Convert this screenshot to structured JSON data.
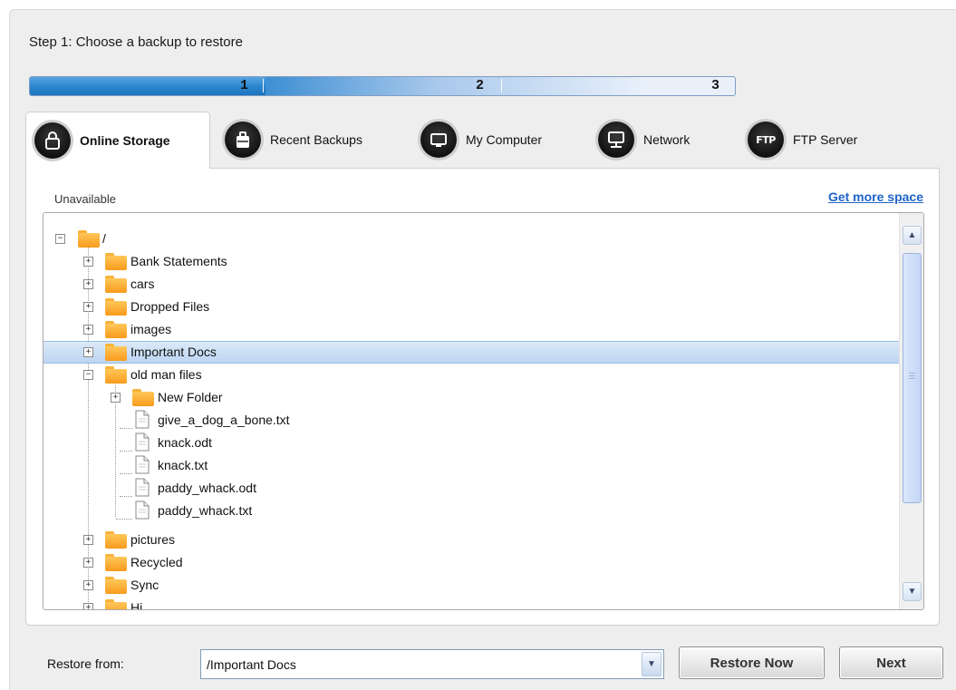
{
  "step_title": "Step 1: Choose a backup to restore",
  "progress": {
    "steps": [
      "1",
      "2",
      "3"
    ],
    "current_step": 1
  },
  "tabs": [
    {
      "label": "Online Storage",
      "icon": "lock-icon",
      "active": true
    },
    {
      "label": "Recent Backups",
      "icon": "briefcase-icon",
      "active": false
    },
    {
      "label": "My Computer",
      "icon": "monitor-icon",
      "active": false
    },
    {
      "label": "Network",
      "icon": "network-monitor-icon",
      "active": false
    },
    {
      "label": "FTP Server",
      "icon": "ftp-icon",
      "active": false
    }
  ],
  "ftp_icon_text": "FTP",
  "storage_status": "Unavailable",
  "more_space_link": "Get more space",
  "tree": {
    "root": "/",
    "items": [
      "Bank Statements",
      "cars",
      "Dropped Files",
      "images",
      "Important Docs",
      "old man files",
      "New Folder",
      "give_a_dog_a_bone.txt",
      "knack.odt",
      "knack.txt",
      "paddy_whack.odt",
      "paddy_whack.txt",
      "pictures",
      "Recycled",
      "Sync",
      "Hi..."
    ],
    "selected": "Important Docs"
  },
  "restore_from_label": "Restore from:",
  "restore_from_value": "/Important Docs",
  "buttons": {
    "restore_now": "Restore Now",
    "next": "Next"
  },
  "colors": {
    "progress": "#2c86d0",
    "link": "#1e64c8",
    "folder": "#f8a52a",
    "selection": "#c5dbf5"
  }
}
